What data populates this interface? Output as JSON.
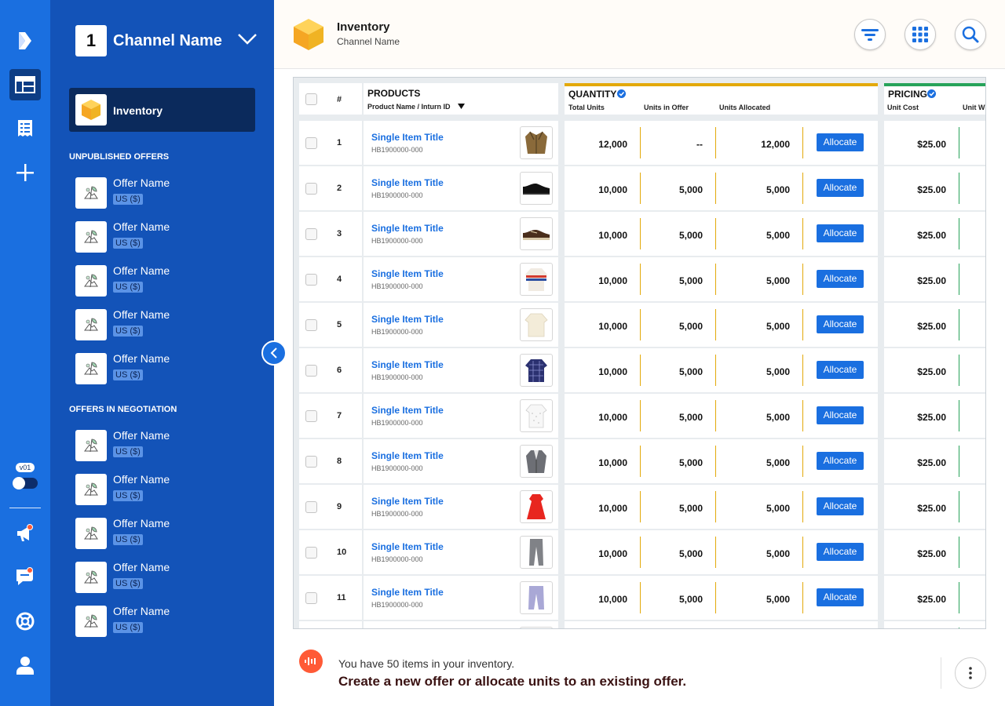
{
  "app": {
    "version": "v01"
  },
  "sidebar": {
    "channel_number": "1",
    "channel_name": "Channel Name",
    "active_item": "Inventory",
    "unpublished_heading": "UNPUBLISHED OFFERS",
    "negotiation_heading": "OFFERS IN NEGOTIATION",
    "unpublished": [
      {
        "name": "Offer Name",
        "currency": "US ($)"
      },
      {
        "name": "Offer Name",
        "currency": "US ($)"
      },
      {
        "name": "Offer Name",
        "currency": "US ($)"
      },
      {
        "name": "Offer Name",
        "currency": "US ($)"
      },
      {
        "name": "Offer Name",
        "currency": "US ($)"
      }
    ],
    "negotiation": [
      {
        "name": "Offer Name",
        "currency": "US ($)"
      },
      {
        "name": "Offer Name",
        "currency": "US ($)"
      },
      {
        "name": "Offer Name",
        "currency": "US ($)"
      },
      {
        "name": "Offer Name",
        "currency": "US ($)"
      },
      {
        "name": "Offer Name",
        "currency": "US ($)"
      }
    ]
  },
  "header": {
    "title": "Inventory",
    "subtitle": "Channel Name"
  },
  "table": {
    "col_number": "#",
    "products_label": "PRODUCTS",
    "products_sub": "Product Name / Inturn ID",
    "quantity_label": "QUANTITY",
    "quantity_cols": [
      "Total Units",
      "Units in Offer",
      "Units Allocated"
    ],
    "pricing_label": "PRICING",
    "pricing_cols": [
      "Unit Cost",
      "Unit W"
    ],
    "allocate_label": "Allocate",
    "rows": [
      {
        "num": "1",
        "title": "Single Item Title",
        "id": "HB1900000-000",
        "total": "12,000",
        "in_offer": "--",
        "allocated": "12,000",
        "cost": "$25.00",
        "img": "jacket"
      },
      {
        "num": "2",
        "title": "Single Item Title",
        "id": "HB1900000-000",
        "total": "10,000",
        "in_offer": "5,000",
        "allocated": "5,000",
        "cost": "$25.00",
        "img": "dress-shoe"
      },
      {
        "num": "3",
        "title": "Single Item Title",
        "id": "HB1900000-000",
        "total": "10,000",
        "in_offer": "5,000",
        "allocated": "5,000",
        "cost": "$25.00",
        "img": "boat-shoe"
      },
      {
        "num": "4",
        "title": "Single Item Title",
        "id": "HB1900000-000",
        "total": "10,000",
        "in_offer": "5,000",
        "allocated": "5,000",
        "cost": "$25.00",
        "img": "striped-sweater"
      },
      {
        "num": "5",
        "title": "Single Item Title",
        "id": "HB1900000-000",
        "total": "10,000",
        "in_offer": "5,000",
        "allocated": "5,000",
        "cost": "$25.00",
        "img": "cream-sweater"
      },
      {
        "num": "6",
        "title": "Single Item Title",
        "id": "HB1900000-000",
        "total": "10,000",
        "in_offer": "5,000",
        "allocated": "5,000",
        "cost": "$25.00",
        "img": "plaid-top"
      },
      {
        "num": "7",
        "title": "Single Item Title",
        "id": "HB1900000-000",
        "total": "10,000",
        "in_offer": "5,000",
        "allocated": "5,000",
        "cost": "$25.00",
        "img": "white-top"
      },
      {
        "num": "8",
        "title": "Single Item Title",
        "id": "HB1900000-000",
        "total": "10,000",
        "in_offer": "5,000",
        "allocated": "5,000",
        "cost": "$25.00",
        "img": "grey-blazer"
      },
      {
        "num": "9",
        "title": "Single Item Title",
        "id": "HB1900000-000",
        "total": "10,000",
        "in_offer": "5,000",
        "allocated": "5,000",
        "cost": "$25.00",
        "img": "red-dress"
      },
      {
        "num": "10",
        "title": "Single Item Title",
        "id": "HB1900000-000",
        "total": "10,000",
        "in_offer": "5,000",
        "allocated": "5,000",
        "cost": "$25.00",
        "img": "grey-trousers"
      },
      {
        "num": "11",
        "title": "Single Item Title",
        "id": "HB1900000-000",
        "total": "10,000",
        "in_offer": "5,000",
        "allocated": "5,000",
        "cost": "$25.00",
        "img": "lavender-trousers"
      }
    ]
  },
  "footer": {
    "message_line1": "You have 50 items in your inventory.",
    "message_line2": "Create a new offer or allocate units to an existing offer."
  },
  "colors": {
    "rail": "#1a6fe0",
    "sidebar": "#1353b8",
    "active": "#0b2a5c",
    "accent": "#1a6fe0",
    "quantity_bar": "#e3a90a",
    "pricing_bar": "#27a35a",
    "alert": "#ff5a36"
  }
}
